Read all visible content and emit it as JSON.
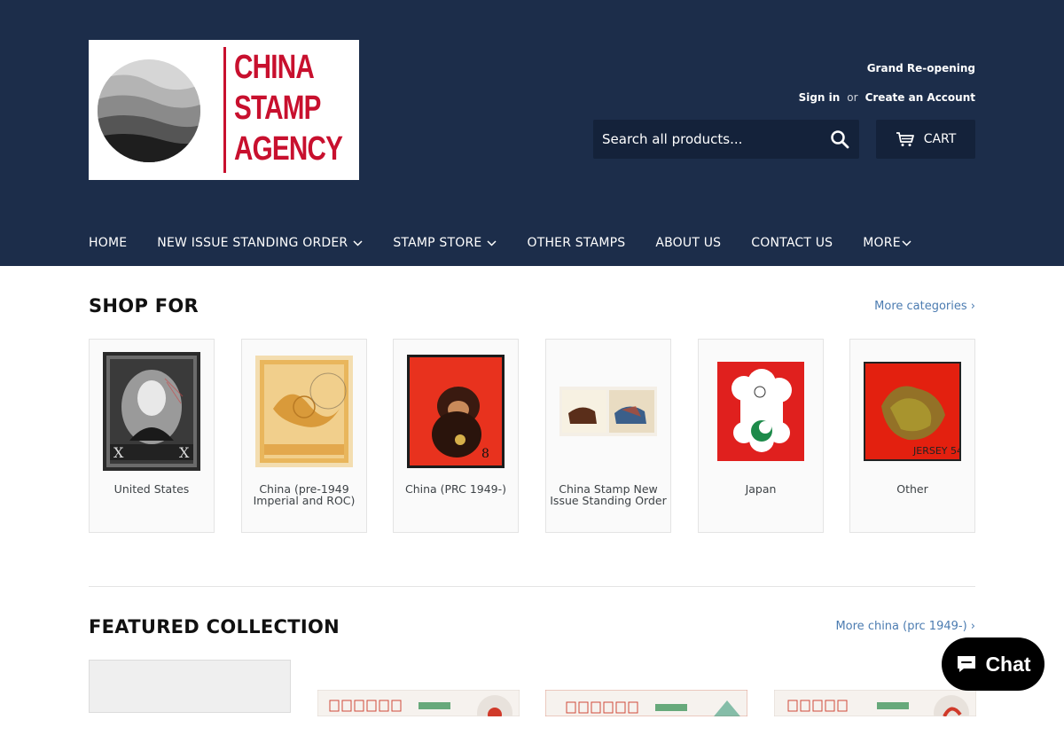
{
  "brand": {
    "logo_lines": [
      "CHINA",
      "STAMP",
      "AGENCY"
    ]
  },
  "header": {
    "announcement": "Grand Re-opening",
    "sign_in": "Sign in",
    "or": "or",
    "create_account": "Create an Account",
    "search_placeholder": "Search all products...",
    "cart_label": "CART"
  },
  "nav": {
    "items": [
      {
        "label": "HOME",
        "dropdown": false
      },
      {
        "label": "NEW ISSUE STANDING ORDER",
        "dropdown": true
      },
      {
        "label": "STAMP STORE",
        "dropdown": true
      },
      {
        "label": "OTHER STAMPS",
        "dropdown": false
      },
      {
        "label": "ABOUT US",
        "dropdown": false
      },
      {
        "label": "CONTACT US",
        "dropdown": false
      },
      {
        "label": "MORE",
        "dropdown": true
      }
    ]
  },
  "shop_for": {
    "title": "SHOP FOR",
    "more_link": "More categories ›",
    "categories": [
      {
        "label": "United States"
      },
      {
        "label": "China (pre-1949 Imperial and ROC)"
      },
      {
        "label": "China (PRC 1949-)"
      },
      {
        "label": "China Stamp New Issue Standing Order"
      },
      {
        "label": "Japan"
      },
      {
        "label": "Other"
      }
    ]
  },
  "featured": {
    "title": "FEATURED COLLECTION",
    "more_link": "More china (prc 1949-) ›"
  },
  "chat": {
    "label": "Chat"
  },
  "colors": {
    "header_bg": "#1c2d4a",
    "link_blue": "#4c7cb1",
    "logo_red": "#c8102e"
  }
}
